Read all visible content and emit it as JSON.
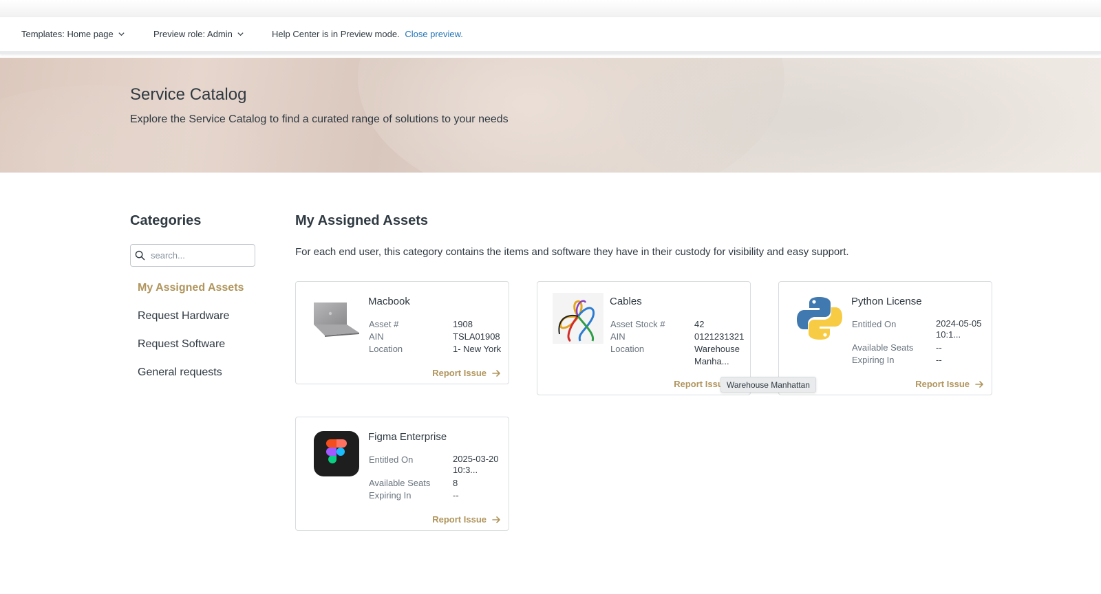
{
  "preview_bar": {
    "templates_label": "Templates: Home page",
    "role_label": "Preview role: Admin",
    "help_text": "Help Center is in Preview mode.",
    "close_link": "Close preview."
  },
  "hero": {
    "title": "Service Catalog",
    "subtitle": "Explore the Service Catalog to find a curated range of solutions to your needs"
  },
  "sidebar": {
    "title": "Categories",
    "search_placeholder": "search...",
    "items": [
      {
        "label": "My Assigned Assets",
        "active": true
      },
      {
        "label": "Request Hardware",
        "active": false
      },
      {
        "label": "Request Software",
        "active": false
      },
      {
        "label": "General requests",
        "active": false
      }
    ]
  },
  "main": {
    "title": "My Assigned Assets",
    "description": "For each end user, this category contains the items and software they have in their custody for visibility and easy support.",
    "report_label": "Report Issue",
    "cards": [
      {
        "name": "Macbook",
        "icon": "laptop-icon",
        "rows": [
          {
            "k": "Asset #",
            "v": "1908"
          },
          {
            "k": "AIN",
            "v": "TSLA01908"
          },
          {
            "k": "Location",
            "v": "1- New York"
          }
        ]
      },
      {
        "name": "Cables",
        "icon": "cables-icon",
        "rows": [
          {
            "k": "Asset Stock #",
            "v": "42"
          },
          {
            "k": "AIN",
            "v": "0121231321"
          },
          {
            "k": "Location",
            "v": "Warehouse Manha..."
          }
        ]
      },
      {
        "name": "Python License",
        "icon": "python-logo-icon",
        "rows": [
          {
            "k": "Entitled On",
            "v": "2024-05-05 10:1..."
          },
          {
            "k": "Available Seats",
            "v": "--"
          },
          {
            "k": "Expiring In",
            "v": "--"
          }
        ]
      },
      {
        "name": "Figma Enterprise",
        "icon": "figma-logo-icon",
        "rows": [
          {
            "k": "Entitled On",
            "v": "2025-03-20 10:3..."
          },
          {
            "k": "Available Seats",
            "v": "8"
          },
          {
            "k": "Expiring In",
            "v": "--"
          }
        ]
      }
    ]
  },
  "tooltip": {
    "text": "Warehouse Manhattan"
  },
  "colors": {
    "accent": "#b0955d",
    "link": "#1f73b7",
    "text": "#2f3941",
    "muted": "#68737d"
  }
}
